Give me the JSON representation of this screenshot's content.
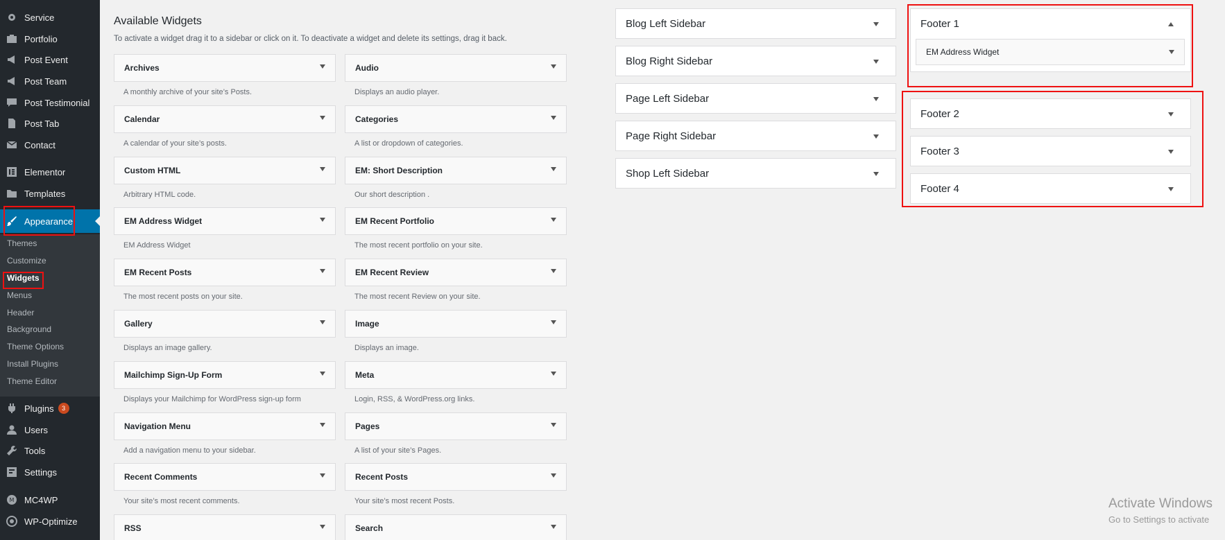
{
  "sidebar": {
    "items": [
      {
        "label": "Service",
        "icon": "gear-icon"
      },
      {
        "label": "Portfolio",
        "icon": "portfolio-icon"
      },
      {
        "label": "Post Event",
        "icon": "megaphone-icon"
      },
      {
        "label": "Post Team",
        "icon": "megaphone-icon"
      },
      {
        "label": "Post Testimonial",
        "icon": "comment-icon"
      },
      {
        "label": "Post Tab",
        "icon": "page-icon"
      },
      {
        "label": "Contact",
        "icon": "mail-icon"
      },
      {
        "label": "Elementor",
        "icon": "elementor-icon"
      },
      {
        "label": "Templates",
        "icon": "folder-icon"
      },
      {
        "label": "Appearance",
        "icon": "brush-icon"
      },
      {
        "label": "Plugins",
        "icon": "plugin-icon",
        "badge": "3"
      },
      {
        "label": "Users",
        "icon": "user-icon"
      },
      {
        "label": "Tools",
        "icon": "wrench-icon"
      },
      {
        "label": "Settings",
        "icon": "settings-icon"
      },
      {
        "label": "MC4WP",
        "icon": "mc4wp-icon"
      },
      {
        "label": "WP-Optimize",
        "icon": "optimize-icon"
      }
    ],
    "submenu": [
      "Themes",
      "Customize",
      "Widgets",
      "Menus",
      "Header",
      "Background",
      "Theme Options",
      "Install Plugins",
      "Theme Editor"
    ]
  },
  "main": {
    "heading": "Available Widgets",
    "description": "To activate a widget drag it to a sidebar or click on it. To deactivate a widget and delete its settings, drag it back.",
    "widgets": [
      {
        "name": "Archives",
        "desc": "A monthly archive of your site’s Posts."
      },
      {
        "name": "Audio",
        "desc": "Displays an audio player."
      },
      {
        "name": "Calendar",
        "desc": "A calendar of your site’s posts."
      },
      {
        "name": "Categories",
        "desc": "A list or dropdown of categories."
      },
      {
        "name": "Custom HTML",
        "desc": "Arbitrary HTML code."
      },
      {
        "name": "EM: Short Description",
        "desc": "Our short description ."
      },
      {
        "name": "EM Address Widget",
        "desc": "EM Address Widget"
      },
      {
        "name": "EM Recent Portfolio",
        "desc": "The most recent portfolio on your site."
      },
      {
        "name": "EM Recent Posts",
        "desc": "The most recent posts on your site."
      },
      {
        "name": "EM Recent Review",
        "desc": "The most recent Review on your site."
      },
      {
        "name": "Gallery",
        "desc": "Displays an image gallery."
      },
      {
        "name": "Image",
        "desc": "Displays an image."
      },
      {
        "name": "Mailchimp Sign-Up Form",
        "desc": "Displays your Mailchimp for WordPress sign-up form"
      },
      {
        "name": "Meta",
        "desc": "Login, RSS, & WordPress.org links."
      },
      {
        "name": "Navigation Menu",
        "desc": "Add a navigation menu to your sidebar."
      },
      {
        "name": "Pages",
        "desc": "A list of your site’s Pages."
      },
      {
        "name": "Recent Comments",
        "desc": "Your site’s most recent comments."
      },
      {
        "name": "Recent Posts",
        "desc": "Your site’s most recent Posts."
      },
      {
        "name": "RSS",
        "desc": ""
      },
      {
        "name": "Search",
        "desc": ""
      }
    ]
  },
  "areas": {
    "left": [
      "Blog Left Sidebar",
      "Blog Right Sidebar",
      "Page Left Sidebar",
      "Page Right Sidebar",
      "Shop Left Sidebar"
    ],
    "footer1": {
      "title": "Footer 1",
      "widget": "EM Address Widget"
    },
    "footers": [
      "Footer 2",
      "Footer 3",
      "Footer 4"
    ]
  },
  "watermark": {
    "line1": "Activate Windows",
    "line2": "Go to Settings to activate"
  }
}
